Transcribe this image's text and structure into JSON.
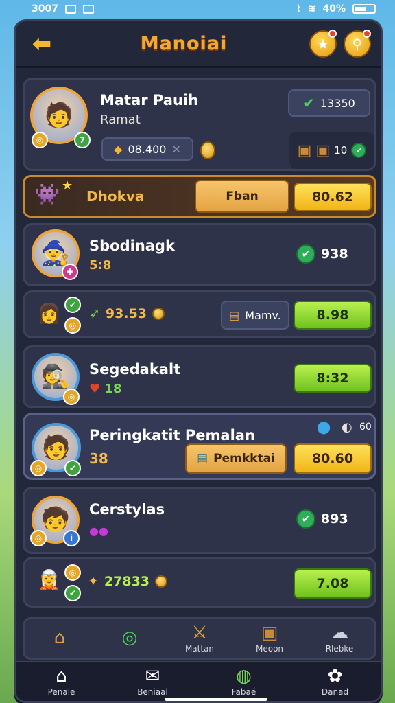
{
  "status": {
    "time": "3007",
    "battery": "40%"
  },
  "header": {
    "title": "Manoiai"
  },
  "profile": {
    "name": "Matar Pauih",
    "subtitle": "Ramat",
    "points": "13350",
    "coins": "08.400",
    "chest_count": "10"
  },
  "banner": {
    "label": "Dhokva",
    "button1": "Fban",
    "button2": "80.62"
  },
  "rows": [
    {
      "name": "Sbodinagk",
      "sub": "5:8",
      "score": "938"
    },
    {
      "reward": "93.53",
      "button1": "Mamv.",
      "button2": "8.98"
    },
    {
      "name": "Segedakalt",
      "sub": "18",
      "button": "8:32"
    },
    {
      "name": "Peringkatit Pemalan",
      "sub": "38",
      "extra": "60",
      "button1": "Pemkktai",
      "button2": "80.60"
    },
    {
      "name": "Cerstylas",
      "score": "893"
    },
    {
      "reward": "27833",
      "button": "7.08"
    }
  ],
  "bottom_tabs": [
    {
      "icon": "house-icon",
      "label": ""
    },
    {
      "icon": "check-circle-icon",
      "label": ""
    },
    {
      "icon": "sword-icon",
      "label": "Mattan"
    },
    {
      "icon": "chest-icon",
      "label": "Meoon"
    },
    {
      "icon": "chat-icon",
      "label": "Rlebke"
    }
  ],
  "nav": [
    {
      "icon": "home-icon",
      "label": "Penale"
    },
    {
      "icon": "mail-icon",
      "label": "Beniaal"
    },
    {
      "icon": "planet-icon",
      "label": "Fabaé"
    },
    {
      "icon": "flower-icon",
      "label": "Danad"
    }
  ]
}
